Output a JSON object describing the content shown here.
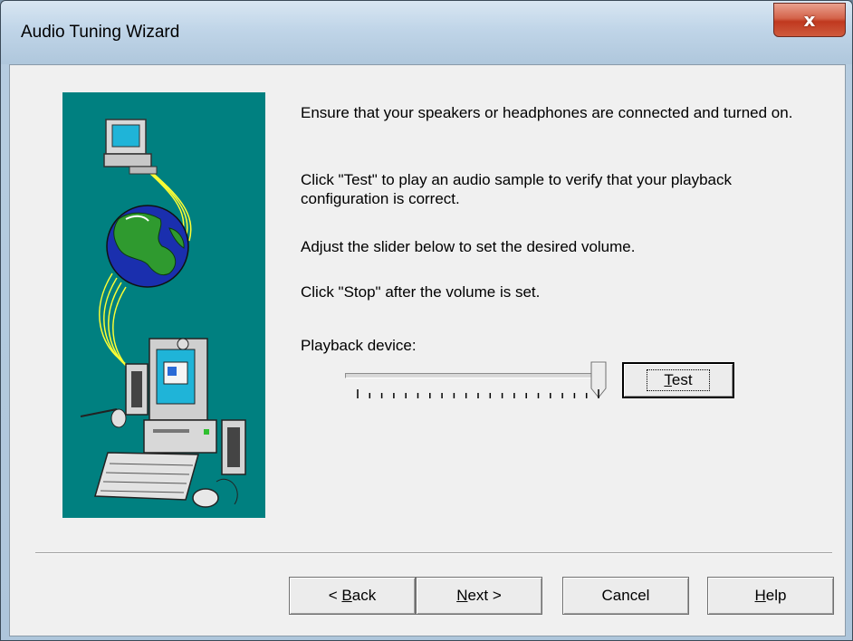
{
  "window": {
    "title": "Audio Tuning Wizard",
    "close_glyph": "x"
  },
  "instructions": [
    "Ensure that your speakers or headphones are connected and turned on.",
    "Click \"Test\" to play an audio sample to verify that your playback configuration is correct.",
    "Adjust the slider below to set the desired volume.",
    "Click \"Stop\" after the volume is set."
  ],
  "playback": {
    "label": "Playback device:",
    "volume_level": 1.0,
    "test_button": {
      "prefix": "",
      "mnemonic": "T",
      "suffix": "est"
    }
  },
  "footer": {
    "back": {
      "prefix": "< ",
      "mnemonic": "B",
      "suffix": "ack"
    },
    "next": {
      "prefix": "",
      "mnemonic": "N",
      "suffix": "ext >"
    },
    "cancel": {
      "label": "Cancel"
    },
    "help": {
      "prefix": "",
      "mnemonic": "H",
      "suffix": "elp"
    }
  },
  "illustration": {
    "icons": [
      "small-computer-icon",
      "globe-icon",
      "desktop-computer-icon",
      "speaker-icon",
      "keyboard-icon",
      "mouse-icon",
      "microphone-icon"
    ],
    "background_color": "#008080"
  },
  "colors": {
    "close_button": "#c8452a",
    "illustration_bg": "#008080"
  }
}
